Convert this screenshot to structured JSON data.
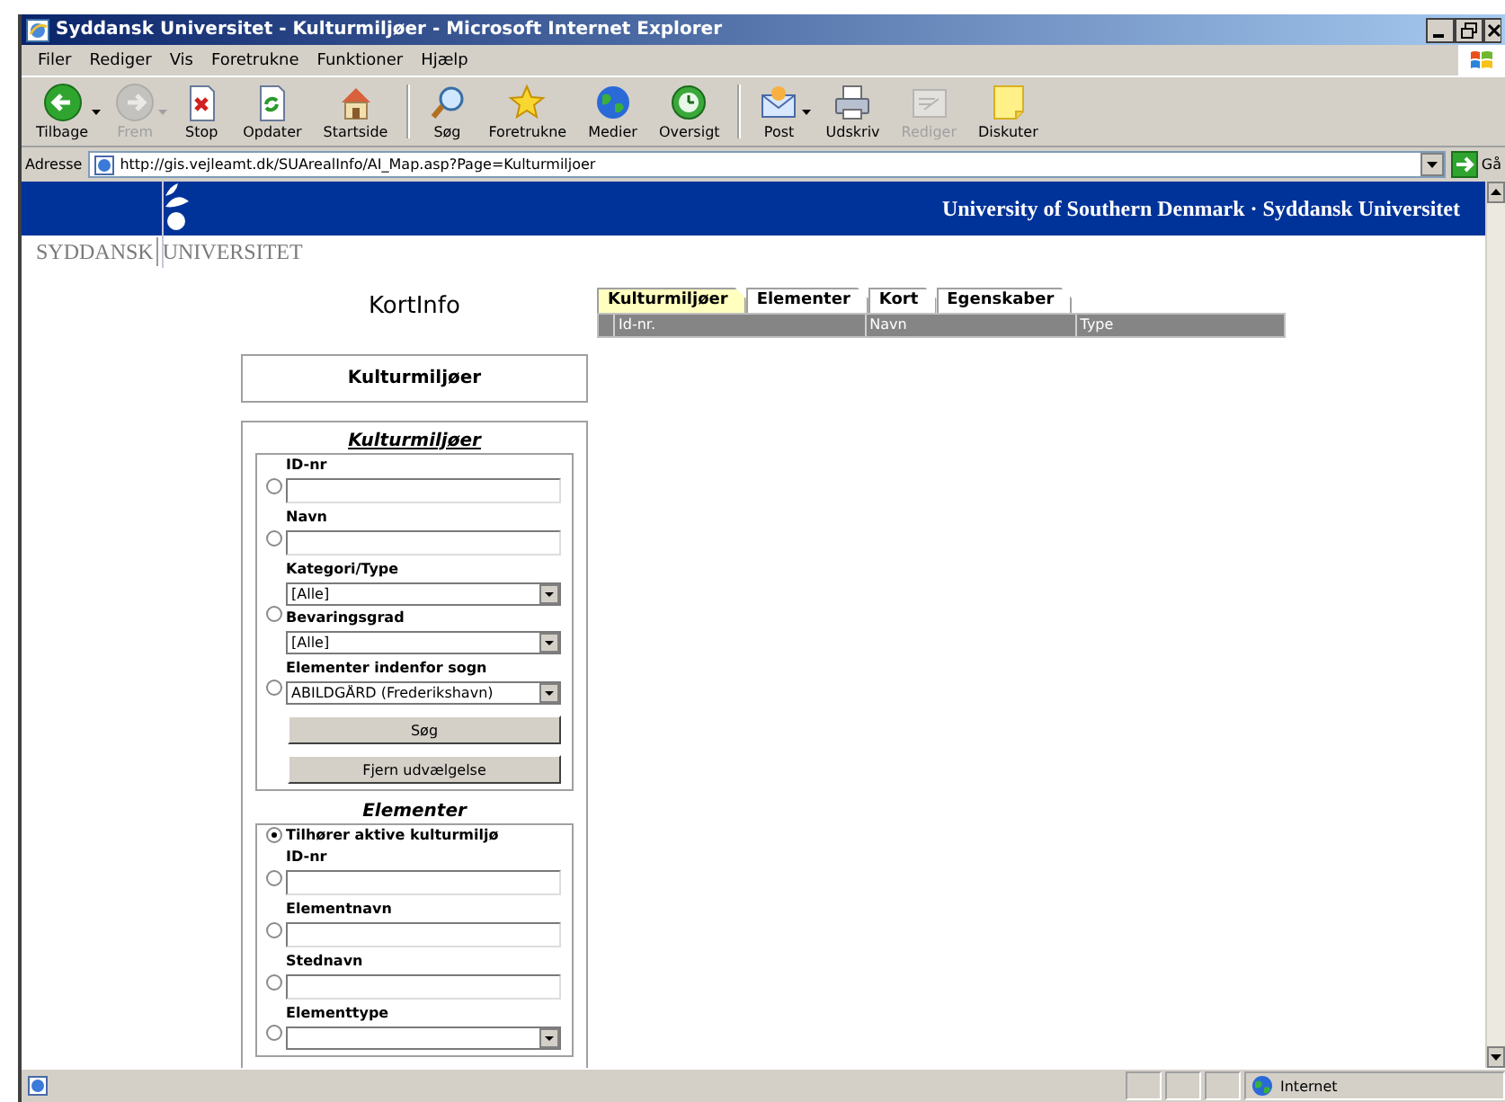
{
  "window": {
    "title": "Syddansk Universitet - Kulturmiljøer - Microsoft Internet Explorer"
  },
  "menu": [
    "Filer",
    "Rediger",
    "Vis",
    "Foretrukne",
    "Funktioner",
    "Hjælp"
  ],
  "toolbar": [
    {
      "label": "Tilbage",
      "disabled": false,
      "has_menu": true
    },
    {
      "label": "Frem",
      "disabled": true,
      "has_menu": true
    },
    {
      "label": "Stop",
      "disabled": false,
      "has_menu": false
    },
    {
      "label": "Opdater",
      "disabled": false,
      "has_menu": false
    },
    {
      "label": "Startside",
      "disabled": false,
      "has_menu": false
    },
    {
      "label": "Søg",
      "disabled": false,
      "has_menu": false
    },
    {
      "label": "Foretrukne",
      "disabled": false,
      "has_menu": false
    },
    {
      "label": "Medier",
      "disabled": false,
      "has_menu": false
    },
    {
      "label": "Oversigt",
      "disabled": false,
      "has_menu": false
    },
    {
      "label": "Post",
      "disabled": false,
      "has_menu": true
    },
    {
      "label": "Udskriv",
      "disabled": false,
      "has_menu": false
    },
    {
      "label": "Rediger",
      "disabled": true,
      "has_menu": false
    },
    {
      "label": "Diskuter",
      "disabled": false,
      "has_menu": false
    }
  ],
  "address": {
    "label": "Adresse",
    "value": "http://gis.vejleamt.dk/SUArealInfo/AI_Map.asp?Page=Kulturmiljoer",
    "go": "Gå"
  },
  "banner": {
    "title": "University of Southern Denmark · Syddansk Universitet"
  },
  "logo": {
    "words": [
      "SYDDANSK",
      "UNIVERSITET"
    ]
  },
  "sidebar": {
    "title": "KortInfo",
    "section": "Kulturmiljøer",
    "kulturmiljoer": {
      "legend": "Kulturmiljøer",
      "groups": [
        {
          "selected": false,
          "fields": [
            {
              "label": "ID-nr",
              "kind": "text"
            }
          ]
        },
        {
          "selected": false,
          "fields": [
            {
              "label": "Navn",
              "kind": "text"
            }
          ]
        },
        {
          "selected": false,
          "fields": [
            {
              "label": "Kategori/Type",
              "kind": "select",
              "value": "[Alle]"
            },
            {
              "label": "Bevaringsgrad",
              "kind": "select",
              "value": "[Alle]"
            }
          ]
        },
        {
          "selected": false,
          "fields": [
            {
              "label": "Elementer indenfor sogn",
              "kind": "select",
              "value": "ABILDGÅRD (Frederikshavn)"
            }
          ]
        }
      ],
      "buttons": [
        "Søg",
        "Fjern udvælgelse"
      ]
    },
    "elementer": {
      "legend": "Elementer",
      "groups": [
        {
          "selected": true,
          "label": "Tilhører aktive kulturmiljø"
        },
        {
          "selected": false,
          "fields": [
            {
              "label": "ID-nr",
              "kind": "text"
            }
          ]
        },
        {
          "selected": false,
          "fields": [
            {
              "label": "Elementnavn",
              "kind": "text"
            }
          ]
        },
        {
          "selected": false,
          "fields": [
            {
              "label": "Stednavn",
              "kind": "text"
            }
          ]
        },
        {
          "selected": false,
          "fields": [
            {
              "label": "Elementtype",
              "kind": "select"
            }
          ]
        }
      ]
    }
  },
  "tabs": [
    {
      "label": "Kulturmiljøer",
      "selected": true
    },
    {
      "label": "Elementer",
      "selected": false
    },
    {
      "label": "Kort",
      "selected": false
    },
    {
      "label": "Egenskaber",
      "selected": false
    }
  ],
  "table": {
    "columns": [
      "Id-nr.",
      "Navn",
      "Type"
    ]
  },
  "status_bar": {
    "zone": "Internet"
  }
}
